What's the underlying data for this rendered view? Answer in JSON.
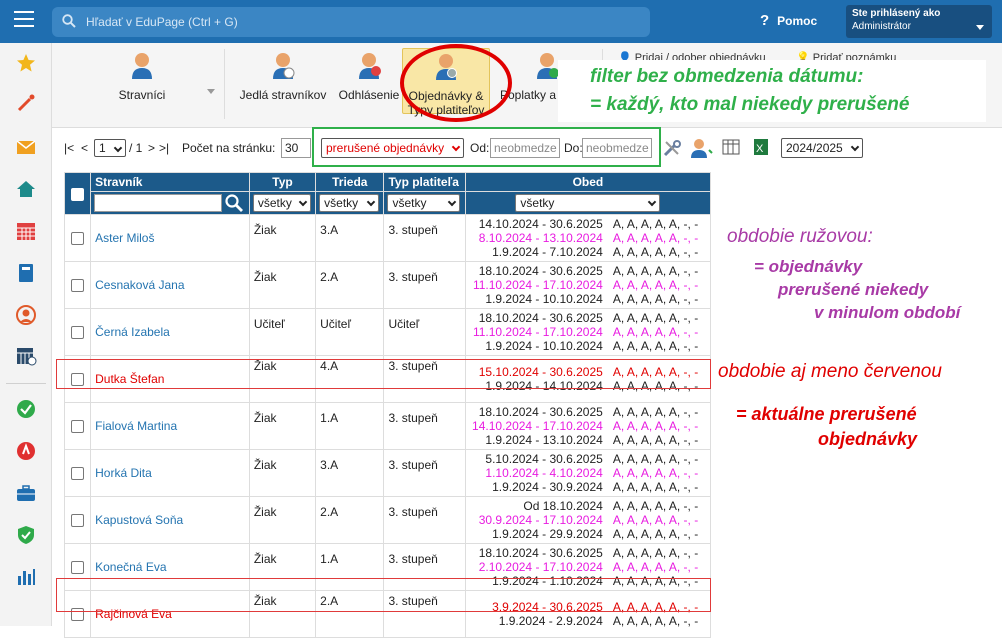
{
  "topbar": {
    "search_placeholder": "Hľadať v EduPage (Ctrl + G)",
    "help_label": "Pomoc",
    "user_line1": "Ste prihlásený ako",
    "user_line2": "Administrátor"
  },
  "sidebar": {
    "icons": [
      "star-icon",
      "magic-wand-icon",
      "envelope-icon",
      "home-icon",
      "calendar-grid-icon",
      "book-icon",
      "user-circle-icon",
      "timetable-icon",
      "check-circle-icon",
      "alert-icon",
      "briefcase-icon",
      "shield-check-icon",
      "bar-chart-icon"
    ],
    "colors": [
      "#f2b61a",
      "#e24a2a",
      "#f0a020",
      "#1d8a8a",
      "#e04040",
      "#1f6eb0",
      "#e05a2a",
      "#2a4a6a",
      "#2faa4a",
      "#e03030",
      "#1f6eb0",
      "#2faa4a",
      "#1f6eb0"
    ]
  },
  "ribbon": {
    "stravnici": "Stravníci",
    "jedla": "Jedlá stravníkov",
    "odhlasenie": "Odhlásenie",
    "objednavky_l1": "Objednávky &",
    "objednavky_l2": "Typy platiteľov",
    "poplatky": "Poplatky a p",
    "pridaj_objednavku": "Pridaj / odober objednávku",
    "pridaj_poznamku": "Pridať poznámku"
  },
  "note_green": {
    "line1": "filter bez obmedzenia dátumu:",
    "line2": "= každý, kto mal niekedy prerušené"
  },
  "toolbar": {
    "first": "|<",
    "prev": "<",
    "page": "1",
    "of": "/ 1",
    "next": ">",
    "last": ">|",
    "per_page_label": "Počet na stránku:",
    "per_page": "30",
    "filter_value": "prerušené objednávky",
    "od_label": "Od:",
    "od_placeholder": "neobmedze",
    "do_label": "Do:",
    "do_placeholder": "neobmedze",
    "year": "2024/2025"
  },
  "table": {
    "headers": [
      "Stravník",
      "Typ",
      "Trieda",
      "Typ platiteľa",
      "Obed"
    ],
    "filters": [
      "všetky",
      "všetky",
      "všetky",
      "všetky"
    ],
    "rows": [
      {
        "name": "Aster Miloš",
        "red": false,
        "typ": "Žiak",
        "trieda": "3.A",
        "platitel": "3. stupeň",
        "lines": [
          {
            "per": "14.10.2024 - 30.6.2025",
            "ab": "A, A, A, A, A, -, -",
            "c": "dark"
          },
          {
            "per": "8.10.2024 - 13.10.2024",
            "ab": "A, A, A, A, A, -, -",
            "c": "pink"
          },
          {
            "per": "1.9.2024 - 7.10.2024",
            "ab": "A, A, A, A, A, -, -",
            "c": "dark"
          }
        ]
      },
      {
        "name": "Cesnaková Jana",
        "red": false,
        "typ": "Žiak",
        "trieda": "2.A",
        "platitel": "3. stupeň",
        "lines": [
          {
            "per": "18.10.2024 - 30.6.2025",
            "ab": "A, A, A, A, A, -, -",
            "c": "dark"
          },
          {
            "per": "11.10.2024 - 17.10.2024",
            "ab": "A, A, A, A, A, -, -",
            "c": "pink"
          },
          {
            "per": "1.9.2024 - 10.10.2024",
            "ab": "A, A, A, A, A, -, -",
            "c": "dark"
          }
        ]
      },
      {
        "name": "Černá Izabela",
        "red": false,
        "typ": "Učiteľ",
        "trieda": "Učiteľ",
        "platitel": "Učiteľ",
        "lines": [
          {
            "per": "18.10.2024 - 30.6.2025",
            "ab": "A, A, A, A, A, -, -",
            "c": "dark"
          },
          {
            "per": "11.10.2024 - 17.10.2024",
            "ab": "A, A, A, A, A, -, -",
            "c": "pink"
          },
          {
            "per": "1.9.2024 - 10.10.2024",
            "ab": "A, A, A, A, A, -, -",
            "c": "dark"
          }
        ]
      },
      {
        "name": "Dutka Štefan",
        "red": true,
        "typ": "Žiak",
        "trieda": "4.A",
        "platitel": "3. stupeň",
        "lines": [
          {
            "per": "15.10.2024 - 30.6.2025",
            "ab": "A, A, A, A, A, -, -",
            "c": "red"
          },
          {
            "per": "1.9.2024 - 14.10.2024",
            "ab": "A, A, A, A, A, -, -",
            "c": "dark"
          }
        ]
      },
      {
        "name": "Fialová Martina",
        "red": false,
        "typ": "Žiak",
        "trieda": "1.A",
        "platitel": "3. stupeň",
        "lines": [
          {
            "per": "18.10.2024 - 30.6.2025",
            "ab": "A, A, A, A, A, -, -",
            "c": "dark"
          },
          {
            "per": "14.10.2024 - 17.10.2024",
            "ab": "A, A, A, A, A, -, -",
            "c": "pink"
          },
          {
            "per": "1.9.2024 - 13.10.2024",
            "ab": "A, A, A, A, A, -, -",
            "c": "dark"
          }
        ]
      },
      {
        "name": "Horká Dita",
        "red": false,
        "typ": "Žiak",
        "trieda": "3.A",
        "platitel": "3. stupeň",
        "lines": [
          {
            "per": "5.10.2024 - 30.6.2025",
            "ab": "A, A, A, A, A, -, -",
            "c": "dark"
          },
          {
            "per": "1.10.2024 - 4.10.2024",
            "ab": "A, A, A, A, A, -, -",
            "c": "pink"
          },
          {
            "per": "1.9.2024 - 30.9.2024",
            "ab": "A, A, A, A, A, -, -",
            "c": "dark"
          }
        ]
      },
      {
        "name": "Kapustová Soňa",
        "red": false,
        "typ": "Žiak",
        "trieda": "2.A",
        "platitel": "3. stupeň",
        "lines": [
          {
            "per": "Od 18.10.2024",
            "ab": "A, A, A, A, A, -, -",
            "c": "dark"
          },
          {
            "per": "30.9.2024 - 17.10.2024",
            "ab": "A, A, A, A, A, -, -",
            "c": "pink"
          },
          {
            "per": "1.9.2024 - 29.9.2024",
            "ab": "A, A, A, A, A, -, -",
            "c": "dark"
          }
        ]
      },
      {
        "name": "Konečná Eva",
        "red": false,
        "typ": "Žiak",
        "trieda": "1.A",
        "platitel": "3. stupeň",
        "lines": [
          {
            "per": "18.10.2024 - 30.6.2025",
            "ab": "A, A, A, A, A, -, -",
            "c": "dark"
          },
          {
            "per": "2.10.2024 - 17.10.2024",
            "ab": "A, A, A, A, A, -, -",
            "c": "pink"
          },
          {
            "per": "1.9.2024 - 1.10.2024",
            "ab": "A, A, A, A, A, -, -",
            "c": "dark"
          }
        ]
      },
      {
        "name": "Rajčinová Eva",
        "red": true,
        "typ": "Žiak",
        "trieda": "2.A",
        "platitel": "3. stupeň",
        "lines": [
          {
            "per": "3.9.2024 - 30.6.2025",
            "ab": "A, A, A, A, A, -, -",
            "c": "red"
          },
          {
            "per": "1.9.2024 - 2.9.2024",
            "ab": "A, A, A, A, A, -, -",
            "c": "dark"
          }
        ]
      }
    ]
  },
  "notes": {
    "pink_l1": "obdobie ružovou:",
    "pink_l2": "=  objednávky",
    "pink_l3": "prerušené niekedy",
    "pink_l4": "v minulom období",
    "red_l1": "obdobie aj meno červenou",
    "red_l2": "=  aktuálne prerušené",
    "red_l3": "objednávky"
  }
}
